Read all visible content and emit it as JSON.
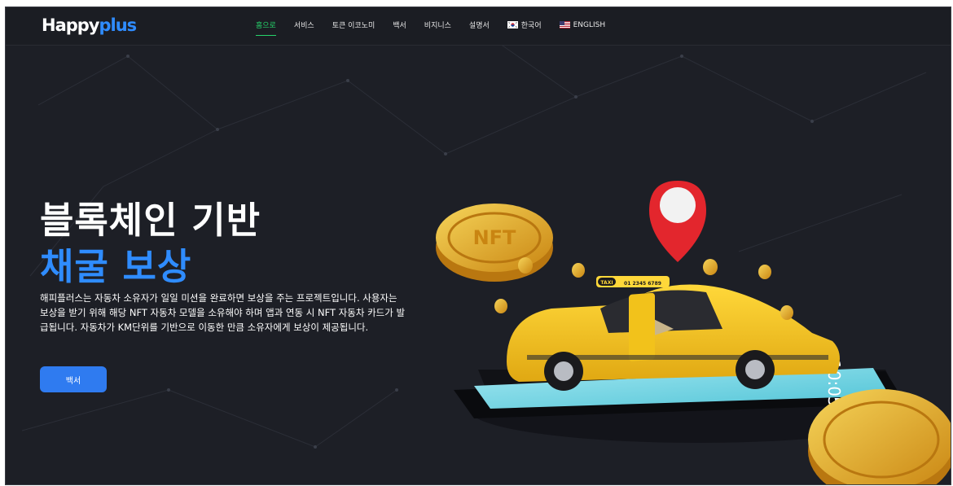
{
  "brand": {
    "logo_main": "Happy",
    "logo_accent": "plus"
  },
  "nav": {
    "items": [
      {
        "label": "홈으로",
        "active": true
      },
      {
        "label": "서비스"
      },
      {
        "label": "토큰 이코노미"
      },
      {
        "label": "백서"
      },
      {
        "label": "비지니스"
      },
      {
        "label": "설명서"
      }
    ],
    "languages": [
      {
        "label": "한국어",
        "flag": "flag-kr-icon"
      },
      {
        "label": "ENGLISH",
        "flag": "flag-us-icon"
      }
    ]
  },
  "hero": {
    "title_line1": "블록체인 기반",
    "title_line2": "채굴 보상",
    "description": "해피플러스는 자동차 소유자가 일일 미션을 완료하면 보상을 주는 프로젝트입니다. 사용자는 보상을 받기 위해 해당 NFT 자동차 모델을 소유해야 하며 앱과 연동 시 NFT 자동차 카드가 발급됩니다. 자동차가 KM단위를 기반으로 이동한 만큼 소유자에게 보상이 제공됩니다.",
    "cta_label": "백서"
  },
  "illustration": {
    "taxi_sign": "TAXI",
    "taxi_plate": "01 2345 6789",
    "phone_time": "10:05",
    "coin_text": "NFT"
  },
  "colors": {
    "background": "#1d1f26",
    "accent_blue": "#2f8cff",
    "active_green": "#26d36b",
    "cta_blue": "#2f7bf0",
    "taxi_yellow": "#f4c21b",
    "pin_red": "#e3262d",
    "gold": "#e3a61c"
  }
}
